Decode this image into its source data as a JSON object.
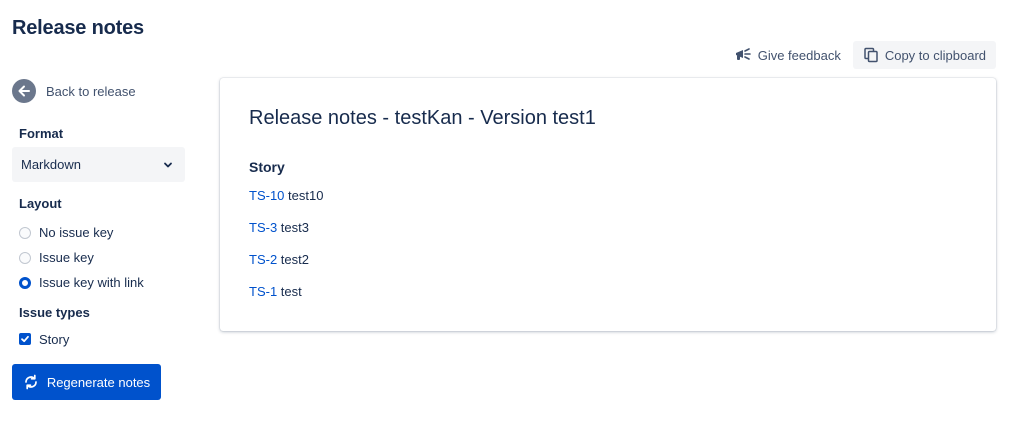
{
  "page": {
    "title": "Release notes"
  },
  "actions": {
    "feedback_label": "Give feedback",
    "copy_label": "Copy to clipboard"
  },
  "sidebar": {
    "back_label": "Back to release",
    "format": {
      "label": "Format",
      "selected": "Markdown"
    },
    "layout": {
      "label": "Layout",
      "options": [
        {
          "label": "No issue key",
          "checked": false
        },
        {
          "label": "Issue key",
          "checked": false
        },
        {
          "label": "Issue key with link",
          "checked": true
        }
      ]
    },
    "issue_types": {
      "label": "Issue types",
      "items": [
        {
          "label": "Story",
          "checked": true
        }
      ]
    },
    "regenerate_label": "Regenerate notes"
  },
  "notes": {
    "title": "Release notes - testKan - Version test1",
    "groups": [
      {
        "heading": "Story",
        "issues": [
          {
            "key": "TS-10",
            "summary": "test10"
          },
          {
            "key": "TS-3",
            "summary": "test3"
          },
          {
            "key": "TS-2",
            "summary": "test2"
          },
          {
            "key": "TS-1",
            "summary": "test"
          }
        ]
      }
    ]
  },
  "colors": {
    "primary": "#0052cc",
    "text": "#172b4d",
    "subtle": "#42526e",
    "surface": "#f4f5f7"
  }
}
